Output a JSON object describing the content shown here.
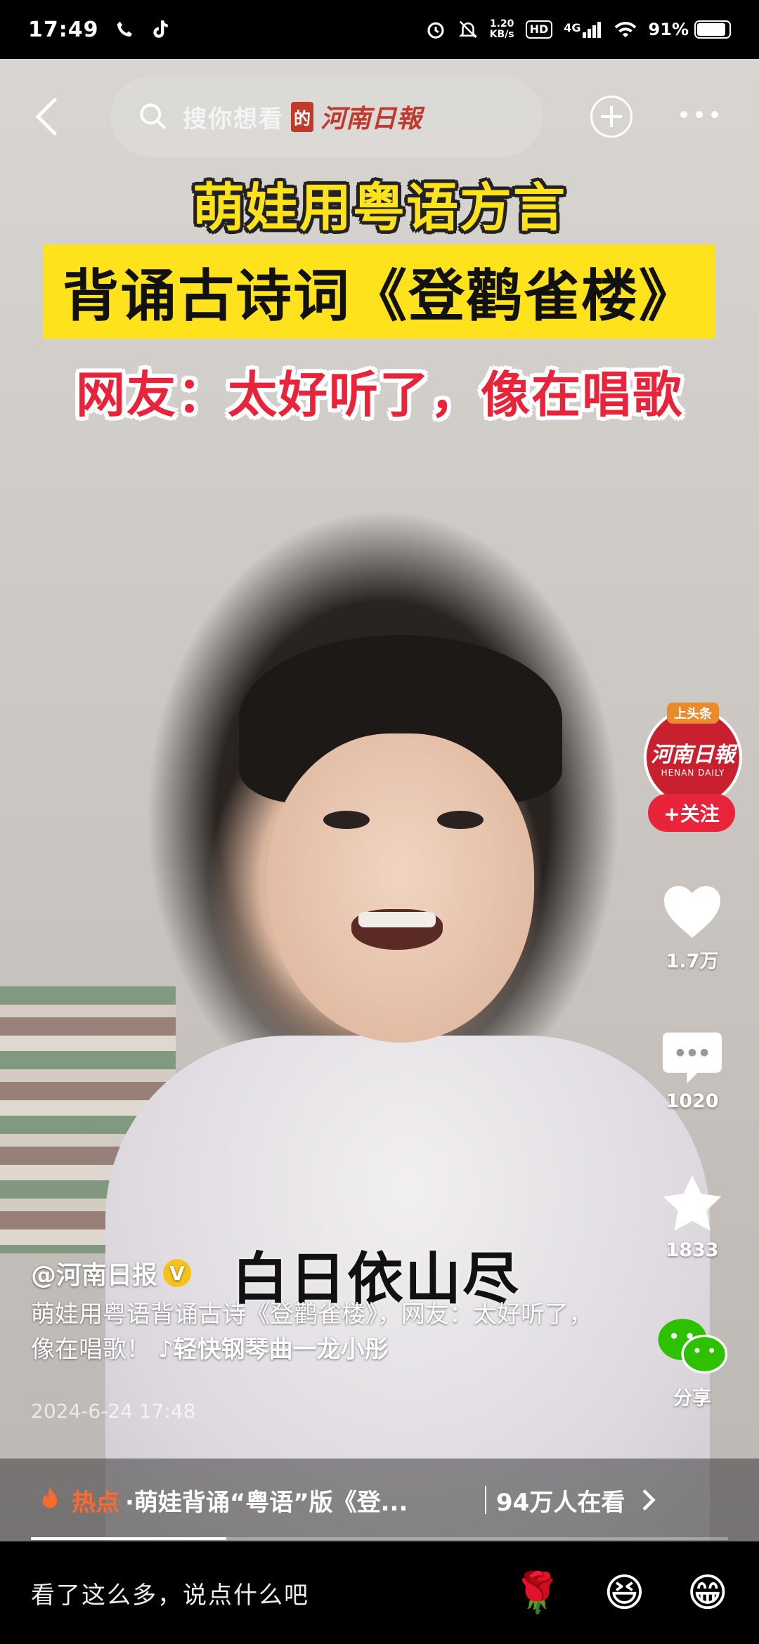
{
  "status_bar": {
    "time": "17:49",
    "net_speed_value": "1.20",
    "net_speed_unit": "KB/s",
    "hd": "HD",
    "network": "4G",
    "battery": "91%",
    "battery_level": 0.91
  },
  "top_bar": {
    "search_placeholder": "搜你想看",
    "brand_badge": "的",
    "brand_name": "河南日報"
  },
  "video_titles": {
    "line1": "萌娃用粤语方言",
    "line2": "背诵古诗词《登鹳雀楼》",
    "line3": "网友：太好听了，像在唱歌"
  },
  "right_rail": {
    "avatar_tag": "上头条",
    "avatar_name": "河南日報",
    "avatar_sub": "HENAN DAILY",
    "follow_label": "+关注",
    "likes": "1.7万",
    "comments": "1020",
    "favorites": "1833",
    "share": "分享"
  },
  "caption": {
    "subtitle": "白日依山尽",
    "author": "@河南日报",
    "verified_mark": "V",
    "description": "萌娃用粤语背诵古诗《登鹳雀楼》，网友：太好听了，像在唱歌！",
    "music": "♪轻快钢琴曲一龙小彤",
    "date": "2024-6-24 17:48"
  },
  "hot_bar": {
    "label": "热点",
    "title": "·萌娃背诵“粤语”版《登...",
    "viewers": "94万人在看"
  },
  "playback_progress": 0.28,
  "comment_bar": {
    "placeholder": "看了这么多，说点什么吧",
    "emoji1": "🌹",
    "emoji2": "😆",
    "emoji3": "😁"
  },
  "colors": {
    "title_yellow": "#fde21c",
    "title_red": "#e8233a",
    "brand_red": "#c0392b",
    "hot_orange": "#ff6a2c",
    "wechat_green": "#2dc100"
  }
}
